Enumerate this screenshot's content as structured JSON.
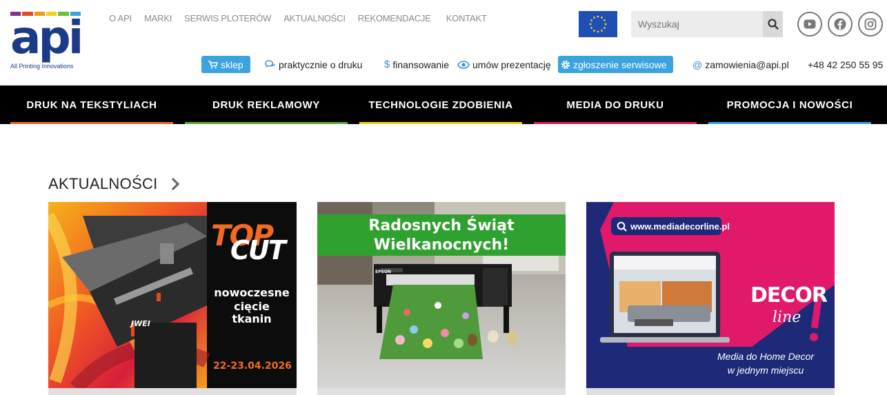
{
  "logo": {
    "word": "api",
    "tagline": "All Printing Innovations",
    "bar_colors": [
      "#8b2f8f",
      "#e64a2b",
      "#f39a1e",
      "#f5d020",
      "#6bbf3a",
      "#3aa3e0"
    ]
  },
  "top_nav": [
    "O API",
    "MARKI",
    "SERWIS PLOTERÓW",
    "AKTUALNOŚCI",
    "REKOMENDACJE",
    "KONTAKT"
  ],
  "search": {
    "placeholder": "Wyszukaj"
  },
  "social_icons": [
    "youtube-icon",
    "facebook-icon",
    "instagram-icon"
  ],
  "utility_bar": {
    "shop": "sklep",
    "print_info": "praktycznie o druku",
    "financing": "finansowanie",
    "presentation": "umów prezentację",
    "service": "zgłoszenie serwisowe",
    "email": "zamowienia@api.pl",
    "phone": "+48 42 250 55 95"
  },
  "main_nav": [
    {
      "label": "DRUK NA TEKSTYLIACH",
      "color": "#e8692b"
    },
    {
      "label": "DRUK REKLAMOWY",
      "color": "#5cae3a"
    },
    {
      "label": "TECHNOLOGIE ZDOBIENIA",
      "color": "#f0d21c"
    },
    {
      "label": "MEDIA DO DRUKU",
      "color": "#d61f64"
    },
    {
      "label": "PROMOCJA I NOWOŚCI",
      "color": "#3aa3e0"
    }
  ],
  "news": {
    "heading": "AKTUALNOŚCI",
    "cards": [
      {
        "brand_top": "TOP",
        "brand_bottom": "CUT",
        "line1": "nowoczesne",
        "line2": "cięcie",
        "line3": "tkanin",
        "date": "22-23.04.2026",
        "machine_badge": "JWEI"
      },
      {
        "line1": "Radosnych Świąt",
        "line2": "Wielkanocnych!",
        "printer_brand": "EPSON"
      },
      {
        "url": "www.mediadecorline.pl",
        "brand_top": "DECOR",
        "brand_bottom": "line",
        "tagline1": "Media do Home Decor",
        "tagline2": "w jednym miejscu"
      }
    ]
  }
}
